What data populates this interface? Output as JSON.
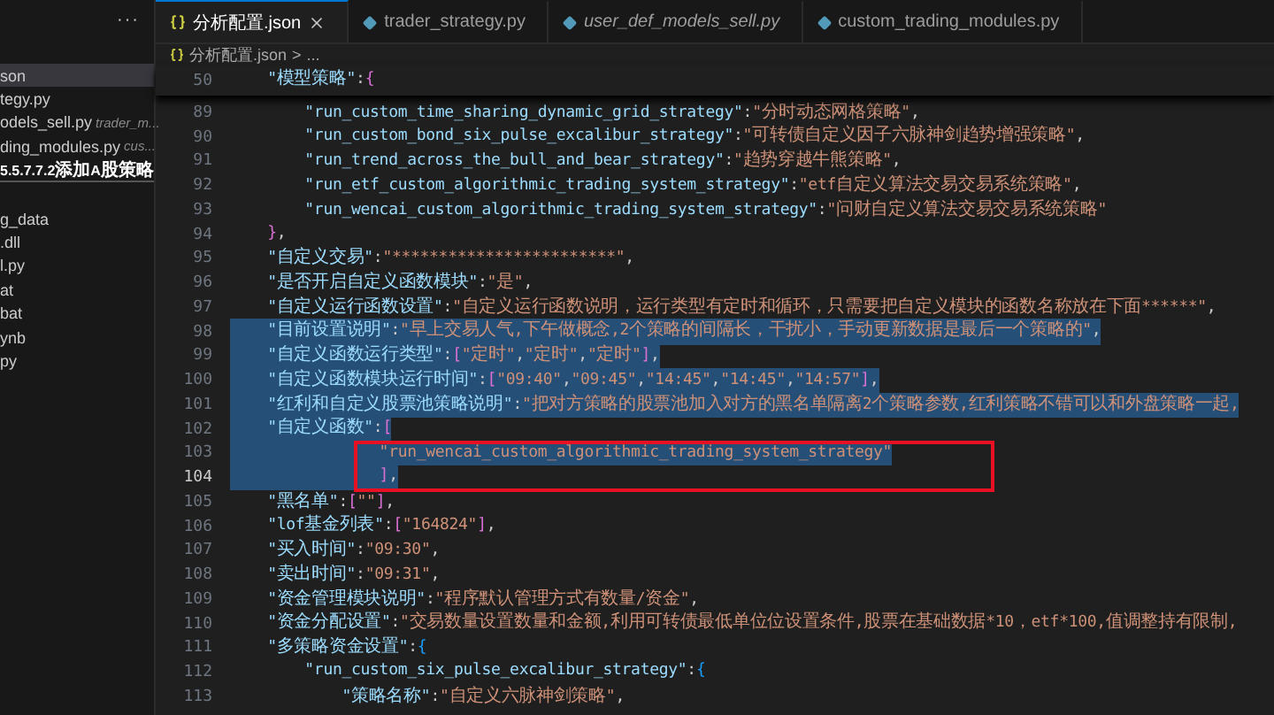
{
  "sidebar": {
    "more": "···",
    "items": [
      {
        "label": "son",
        "selected": true,
        "kind": "file"
      },
      {
        "label": "tegy.py",
        "selected": false,
        "kind": "file"
      },
      {
        "label": "odels_sell.py",
        "description": "trader_m...",
        "selected": false,
        "kind": "file"
      },
      {
        "label": "ding_modules.py",
        "description": "cus...",
        "selected": false,
        "kind": "file"
      },
      {
        "label": "5.5.7.7.2添加A股策略",
        "selected": false,
        "kind": "folder"
      },
      {
        "label": "g_data",
        "selected": false,
        "kind": "file"
      },
      {
        "label": ".dll",
        "selected": false,
        "kind": "file"
      },
      {
        "label": "l.py",
        "selected": false,
        "kind": "file"
      },
      {
        "label": "at",
        "selected": false,
        "kind": "file"
      },
      {
        "label": "bat",
        "selected": false,
        "kind": "file"
      },
      {
        "label": "ynb",
        "selected": false,
        "kind": "file"
      },
      {
        "label": "py",
        "selected": false,
        "kind": "file"
      }
    ]
  },
  "tabs": [
    {
      "label": "分析配置.json",
      "selected": true,
      "kind": "json",
      "preview": false
    },
    {
      "label": "trader_strategy.py",
      "selected": false,
      "kind": "python",
      "preview": false
    },
    {
      "label": "user_def_models_sell.py",
      "selected": false,
      "kind": "python",
      "preview": true
    },
    {
      "label": "custom_trading_modules.py",
      "selected": false,
      "kind": "python",
      "preview": false
    }
  ],
  "breadcrumb": {
    "file": "分析配置.json",
    "separator": ">",
    "rest": "..."
  },
  "sticky_line": {
    "number": "50",
    "text": "    \"模型策略\":{"
  },
  "lines": [
    {
      "number": "89",
      "text": "        \"run_custom_time_sharing_dynamic_grid_strategy\":\"分时动态网格策略\",",
      "selected": false,
      "current": false,
      "boxed": false
    },
    {
      "number": "90",
      "text": "        \"run_custom_bond_six_pulse_excalibur_strategy\":\"可转债自定义因子六脉神剑趋势增强策略\",",
      "selected": false,
      "current": false,
      "boxed": false
    },
    {
      "number": "91",
      "text": "        \"run_trend_across_the_bull_and_bear_strategy\":\"趋势穿越牛熊策略\",",
      "selected": false,
      "current": false,
      "boxed": false
    },
    {
      "number": "92",
      "text": "        \"run_etf_custom_algorithmic_trading_system_strategy\":\"etf自定义算法交易交易系统策略\",",
      "selected": false,
      "current": false,
      "boxed": false
    },
    {
      "number": "93",
      "text": "        \"run_wencai_custom_algorithmic_trading_system_strategy\":\"问财自定义算法交易交易系统策略\"",
      "selected": false,
      "current": false,
      "boxed": false
    },
    {
      "number": "94",
      "text": "    },",
      "selected": false,
      "current": false,
      "boxed": false
    },
    {
      "number": "95",
      "text": "    \"自定义交易\":\"************************\",",
      "selected": false,
      "current": false,
      "boxed": false
    },
    {
      "number": "96",
      "text": "    \"是否开启自定义函数模块\":\"是\",",
      "selected": false,
      "current": false,
      "boxed": false
    },
    {
      "number": "97",
      "text": "    \"自定义运行函数设置\":\"自定义运行函数说明，运行类型有定时和循环，只需要把自定义模块的函数名称放在下面******\",",
      "selected": false,
      "current": false,
      "boxed": false
    },
    {
      "number": "98",
      "text": "    \"目前设置说明\":\"早上交易人气,下午做概念,2个策略的间隔长，干扰小，手动更新数据是最后一个策略的\",",
      "selected": true,
      "current": false,
      "boxed": false
    },
    {
      "number": "99",
      "text": "    \"自定义函数运行类型\":[\"定时\",\"定时\",\"定时\"],",
      "selected": true,
      "current": false,
      "boxed": false
    },
    {
      "number": "100",
      "text": "    \"自定义函数模块运行时间\":[\"09:40\",\"09:45\",\"14:45\",\"14:45\",\"14:57\"],",
      "selected": true,
      "current": false,
      "boxed": false
    },
    {
      "number": "101",
      "text": "    \"红利和自定义股票池策略说明\":\"把对方策略的股票池加入对方的黑名单隔离2个策略参数,红利策略不错可以和外盘策略一起,",
      "selected": true,
      "current": false,
      "boxed": false
    },
    {
      "number": "102",
      "text": "    \"自定义函数\":[",
      "selected": true,
      "current": false,
      "boxed": false
    },
    {
      "number": "103",
      "text": "                \"run_wencai_custom_algorithmic_trading_system_strategy\"",
      "selected": true,
      "current": false,
      "boxed": true
    },
    {
      "number": "104",
      "text": "                ],",
      "selected": true,
      "current": true,
      "boxed": true
    },
    {
      "number": "105",
      "text": "    \"黑名单\":[\"\"],",
      "selected": false,
      "current": false,
      "boxed": false
    },
    {
      "number": "106",
      "text": "    \"lof基金列表\":[\"164824\"],",
      "selected": false,
      "current": false,
      "boxed": false
    },
    {
      "number": "107",
      "text": "    \"买入时间\":\"09:30\",",
      "selected": false,
      "current": false,
      "boxed": false
    },
    {
      "number": "108",
      "text": "    \"卖出时间\":\"09:31\",",
      "selected": false,
      "current": false,
      "boxed": false
    },
    {
      "number": "109",
      "text": "    \"资金管理模块说明\":\"程序默认管理方式有数量/资金\",",
      "selected": false,
      "current": false,
      "boxed": false
    },
    {
      "number": "110",
      "text": "    \"资金分配设置\":\"交易数量设置数量和金额,利用可转债最低单位位设置条件,股票在基础数据*10，etf*100,值调整持有限制,",
      "selected": false,
      "current": false,
      "boxed": false
    },
    {
      "number": "111",
      "text": "    \"多策略资金设置\":{",
      "selected": false,
      "current": false,
      "boxed": false
    },
    {
      "number": "112",
      "text": "        \"run_custom_six_pulse_excalibur_strategy\":{",
      "selected": false,
      "current": false,
      "boxed": false
    },
    {
      "number": "113",
      "text": "            \"策略名称\":\"自定义六脉神剑策略\",",
      "selected": false,
      "current": false,
      "boxed": false
    }
  ]
}
